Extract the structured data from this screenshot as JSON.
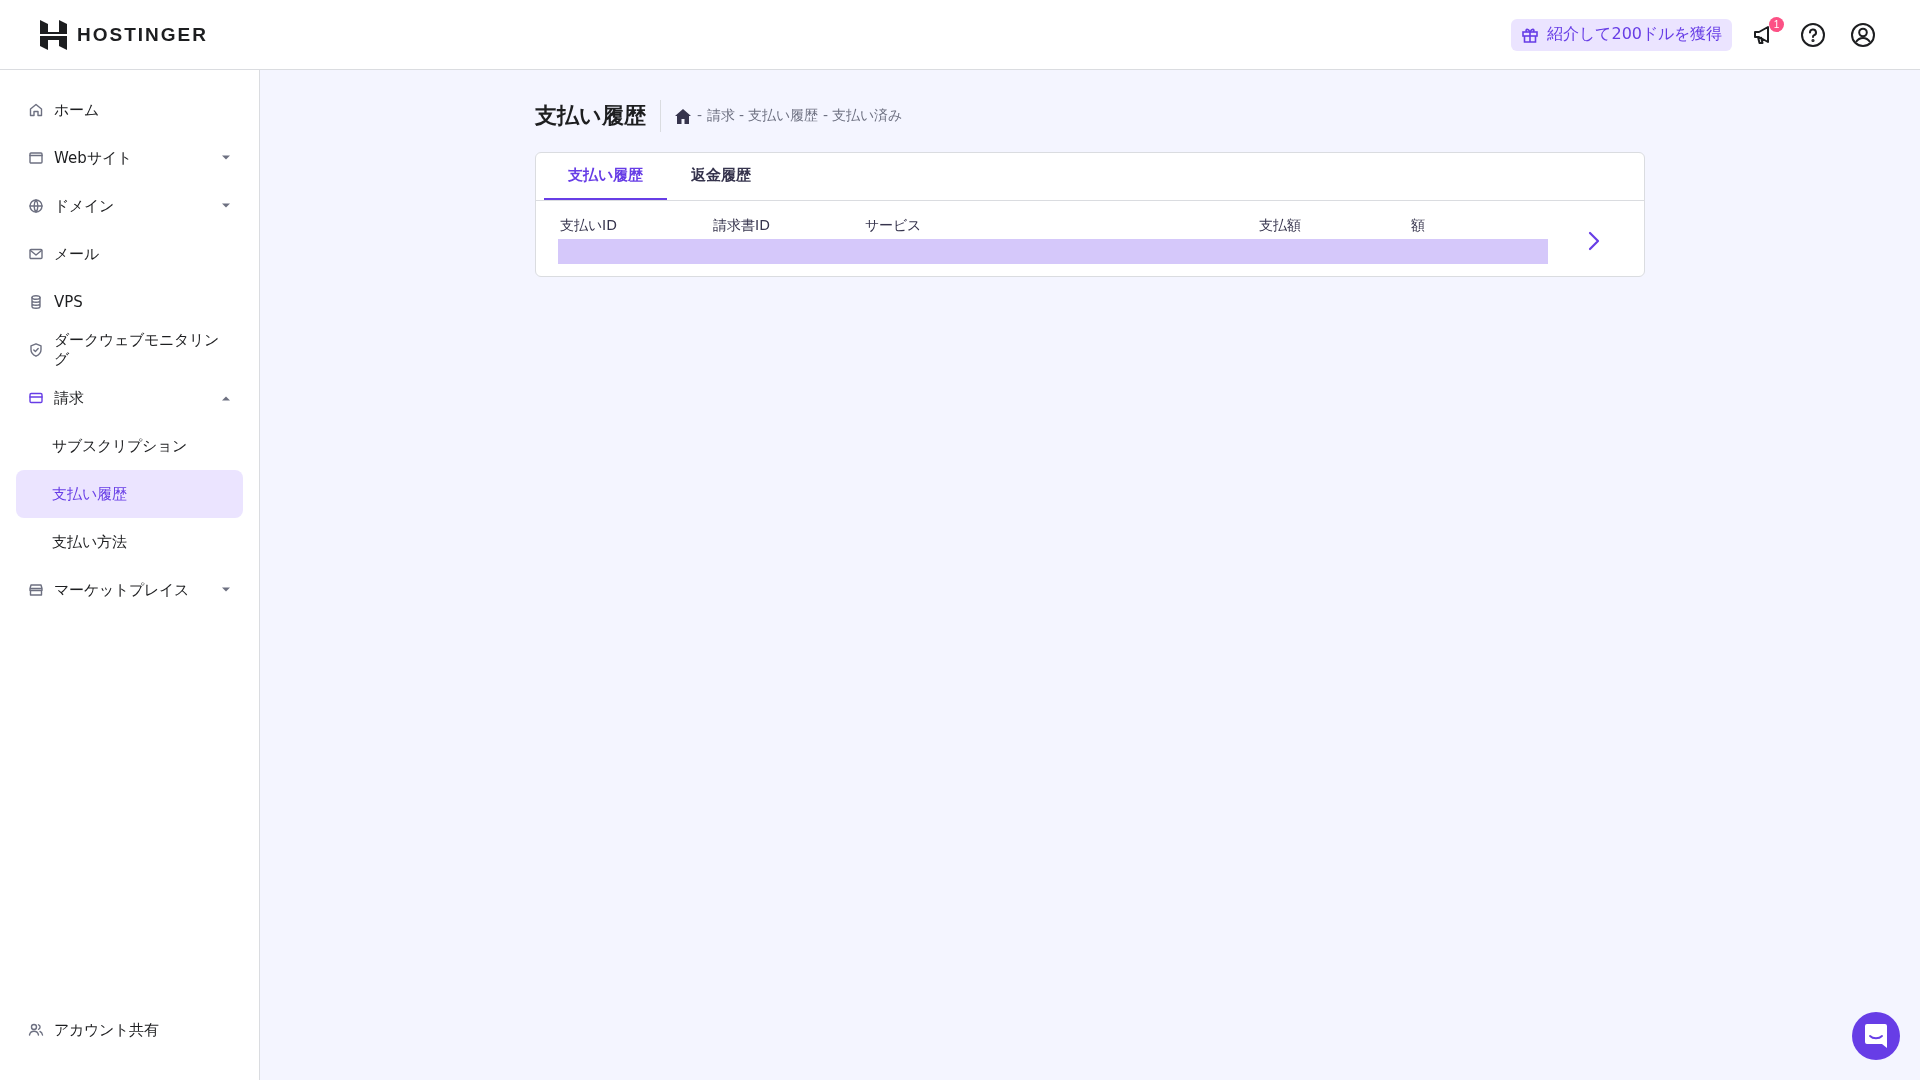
{
  "header": {
    "logo": "HOSTINGER",
    "referral": "紹介して200ドルを獲得",
    "notification_count": "1"
  },
  "sidebar": {
    "items": [
      {
        "label": "ホーム",
        "selected": false
      },
      {
        "label": "Webサイト",
        "selected": false,
        "expanded": false
      },
      {
        "label": "ドメイン",
        "selected": false,
        "expanded": false
      },
      {
        "label": "メール",
        "selected": false
      },
      {
        "label": "VPS",
        "selected": false
      },
      {
        "label": "ダークウェブモニタリング",
        "selected": false
      },
      {
        "label": "請求",
        "selected": false,
        "expanded": true,
        "children": [
          {
            "label": "サブスクリプション",
            "selected": false
          },
          {
            "label": "支払い履歴",
            "selected": true
          },
          {
            "label": "支払い方法",
            "selected": false
          }
        ]
      },
      {
        "label": "マーケットプレイス",
        "selected": false,
        "expanded": false
      }
    ],
    "footer": "アカウント共有"
  },
  "page": {
    "title": "支払い履歴",
    "breadcrumb": "- 請求 - 支払い履歴 - 支払い済み"
  },
  "tabs": [
    {
      "label": "支払い履歴",
      "selected": true
    },
    {
      "label": "返金履歴",
      "selected": false
    }
  ],
  "table": {
    "columns": [
      "支払いID",
      "請求書ID",
      "サービス",
      "支払額",
      "額"
    ]
  }
}
